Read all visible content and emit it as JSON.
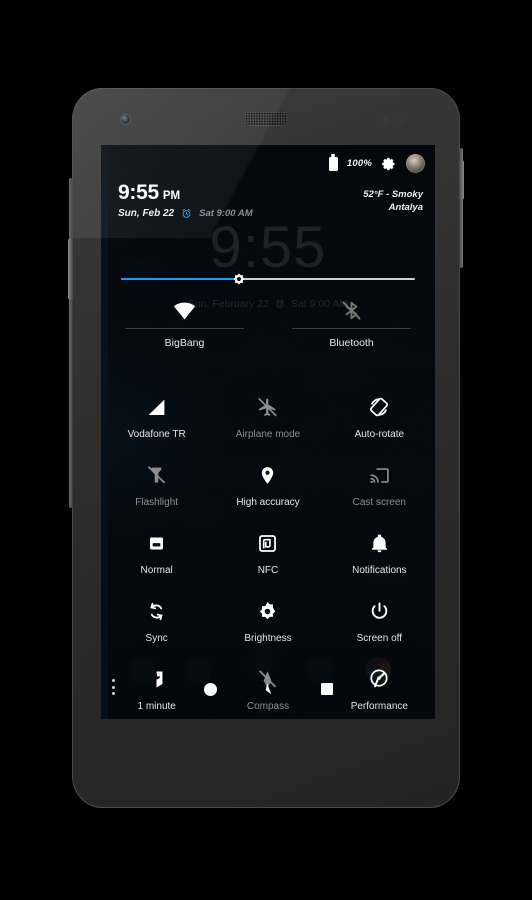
{
  "device": {
    "kind": "android-phone",
    "front_camera": "camera-icon",
    "earpiece": "speaker-grille"
  },
  "statusbar": {
    "battery_icon": "battery-full-icon",
    "battery_percent": "100%",
    "settings_icon": "gear-icon",
    "avatar": "user-avatar"
  },
  "header": {
    "time": "9:55",
    "ampm": "PM",
    "date": "Sun, Feb 22",
    "alarm_icon": "alarm-clock-icon",
    "alarm_time": "Sat 9:00 AM",
    "weather_line1": "52°F - Smoky",
    "weather_line2": "Antalya",
    "accent_color": "#2196f3"
  },
  "background_clock": {
    "time": "9:55",
    "date": "Sun, February 22",
    "alarm_icon": "alarm-clock-icon",
    "alarm_time": "Sat 9:00 AM"
  },
  "brightness_slider": {
    "name": "brightness-slider",
    "value_percent": 40,
    "thumb_icon": "sun-brightness-icon",
    "fill_color": "#2196f3",
    "track_color": "#cfcfcf"
  },
  "primary_tiles": [
    {
      "label": "BigBang",
      "icon": "wifi-icon",
      "state": "on"
    },
    {
      "label": "Bluetooth",
      "icon": "bluetooth-off-icon",
      "state": "off"
    }
  ],
  "tiles": [
    {
      "label": "Vodafone TR",
      "icon": "cell-signal-icon",
      "state": "on"
    },
    {
      "label": "Airplane mode",
      "icon": "airplane-off-icon",
      "state": "off"
    },
    {
      "label": "Auto-rotate",
      "icon": "auto-rotate-icon",
      "state": "on"
    },
    {
      "label": "Flashlight",
      "icon": "flashlight-off-icon",
      "state": "off"
    },
    {
      "label": "High accuracy",
      "icon": "location-pin-icon",
      "state": "on"
    },
    {
      "label": "Cast screen",
      "icon": "cast-screen-icon",
      "state": "off"
    },
    {
      "label": "Normal",
      "icon": "ringer-normal-icon",
      "state": "on"
    },
    {
      "label": "NFC",
      "icon": "nfc-icon",
      "state": "on"
    },
    {
      "label": "Notifications",
      "icon": "bell-icon",
      "state": "on"
    },
    {
      "label": "Sync",
      "icon": "sync-icon",
      "state": "on"
    },
    {
      "label": "Brightness",
      "icon": "brightness-icon",
      "state": "on"
    },
    {
      "label": "Screen off",
      "icon": "power-icon",
      "state": "on"
    },
    {
      "label": "1 minute",
      "icon": "screen-timeout-icon",
      "state": "on"
    },
    {
      "label": "Compass",
      "icon": "compass-off-icon",
      "state": "off"
    },
    {
      "label": "Performance",
      "icon": "performance-icon",
      "state": "on"
    }
  ],
  "overflow": {
    "icon": "more-vertical-icon"
  },
  "navbar": {
    "back": "back-circle-icon",
    "home": "home-icon",
    "recents": "recents-square-icon"
  }
}
